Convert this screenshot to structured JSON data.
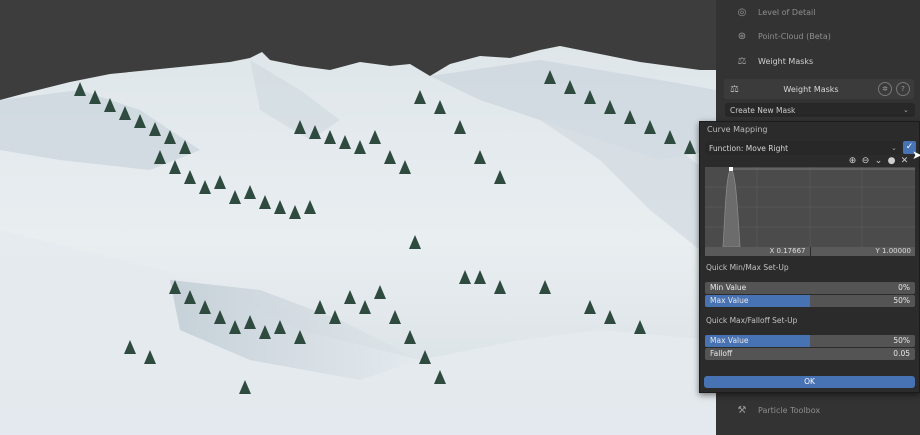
{
  "sidebar": {
    "items": [
      {
        "label": "Level of Detail",
        "icon": "lod-icon"
      },
      {
        "label": "Point-Cloud (Beta)",
        "icon": "point-cloud-icon"
      },
      {
        "label": "Weight Masks",
        "icon": "weight-masks-icon"
      }
    ],
    "bottom_items": [
      {
        "label": "Particle Toolbox",
        "icon": "particle-toolbox-icon"
      }
    ]
  },
  "weight_masks_panel": {
    "title": "Weight Masks",
    "create_new_mask_label": "Create New Mask"
  },
  "curve_mapping_popup": {
    "title": "Curve Mapping",
    "function_label": "Function: Move Right",
    "checkbox_checked": true,
    "x_readout": "X 0.17667",
    "y_readout": "Y 1.00000",
    "quick_minmax_title": "Quick Min/Max Set-Up",
    "min_value_label": "Min Value",
    "min_value": "0%",
    "min_value_fraction": 0.0,
    "max_value_label": "Max Value",
    "max_value": "50%",
    "max_value_fraction": 0.5,
    "quick_falloff_title": "Quick Max/Falloff Set-Up",
    "falloff_max_label": "Max Value",
    "falloff_max_value": "50%",
    "falloff_max_fraction": 0.5,
    "falloff_label": "Falloff",
    "falloff_value": "0.05",
    "ok_label": "OK"
  },
  "colors": {
    "accent": "#4772b3",
    "panel_bg": "#2b2b2b",
    "sidebar_bg": "#333333",
    "snow": "#e8eef2",
    "trees": "#2e4a3d"
  }
}
